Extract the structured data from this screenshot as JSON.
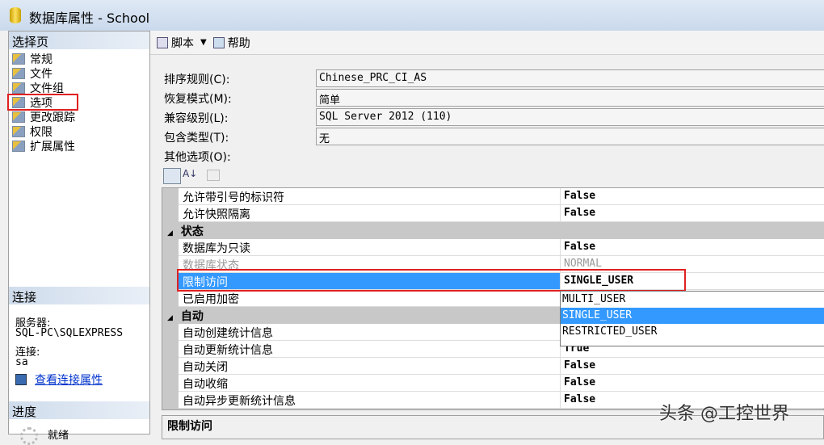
{
  "window": {
    "title": "数据库属性 - School"
  },
  "sidebar": {
    "header": "选择页",
    "items": [
      {
        "label": "常规"
      },
      {
        "label": "文件"
      },
      {
        "label": "文件组"
      },
      {
        "label": "选项"
      },
      {
        "label": "更改跟踪"
      },
      {
        "label": "权限"
      },
      {
        "label": "扩展属性"
      }
    ],
    "selected": "选项"
  },
  "connection": {
    "header": "连接",
    "server_label": "服务器:",
    "server": "SQL-PC\\SQLEXPRESS",
    "conn_label": "连接:",
    "user": "sa",
    "link": "查看连接属性"
  },
  "progress": {
    "header": "进度",
    "status": "就绪"
  },
  "toolbar": {
    "script": "脚本",
    "help": "帮助"
  },
  "form": {
    "collation_label": "排序规则(C):",
    "collation": "Chinese_PRC_CI_AS",
    "recovery_label": "恢复模式(M):",
    "recovery": "简单",
    "compat_label": "兼容级别(L):",
    "compat": "SQL Server 2012 (110)",
    "containment_label": "包含类型(T):",
    "containment": "无",
    "other_label": "其他选项(O):"
  },
  "grid": {
    "rows_top": [
      {
        "name": "允许带引号的标识符",
        "value": "False"
      },
      {
        "name": "允许快照隔离",
        "value": "False"
      }
    ],
    "cat_state": "状态",
    "rows_state": [
      {
        "name": "数据库为只读",
        "value": "False"
      },
      {
        "name": "数据库状态",
        "value": "NORMAL"
      },
      {
        "name": "限制访问",
        "value": "SINGLE_USER"
      },
      {
        "name": "已启用加密",
        "value": ""
      }
    ],
    "cat_auto": "自动",
    "rows_auto": [
      {
        "name": "自动创建统计信息",
        "value": ""
      },
      {
        "name": "自动更新统计信息",
        "value": "True"
      },
      {
        "name": "自动关闭",
        "value": "False"
      },
      {
        "name": "自动收缩",
        "value": "False"
      },
      {
        "name": "自动异步更新统计信息",
        "value": "False"
      }
    ]
  },
  "dropdown": {
    "options": [
      "MULTI_USER",
      "SINGLE_USER",
      "RESTRICTED_USER"
    ],
    "selected": "SINGLE_USER"
  },
  "description": {
    "title": "限制访问"
  },
  "watermark": "头条 @工控世界"
}
